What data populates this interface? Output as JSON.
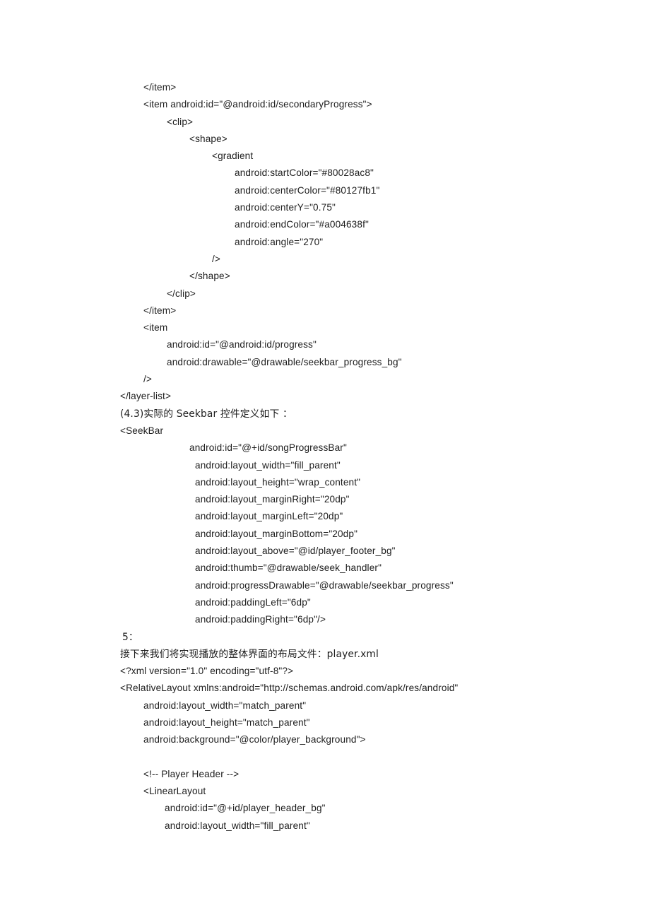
{
  "document": {
    "page_background": "#ffffff",
    "text_color": "#1d1d1d",
    "lines": [
      {
        "indent": "i1",
        "text": "</item>"
      },
      {
        "indent": "i1",
        "text": "<item android:id=\"@android:id/secondaryProgress\">"
      },
      {
        "indent": "i2",
        "text": "<clip>"
      },
      {
        "indent": "i3",
        "text": "<shape>"
      },
      {
        "indent": "i4",
        "text": "<gradient"
      },
      {
        "indent": "i5",
        "text": "android:startColor=\"#80028ac8\""
      },
      {
        "indent": "i5",
        "text": "android:centerColor=\"#80127fb1\""
      },
      {
        "indent": "i5",
        "text": "android:centerY=\"0.75\""
      },
      {
        "indent": "i5",
        "text": "android:endColor=\"#a004638f\""
      },
      {
        "indent": "i5",
        "text": "android:angle=\"270\""
      },
      {
        "indent": "i4",
        "text": "/>"
      },
      {
        "indent": "i3",
        "text": "</shape>"
      },
      {
        "indent": "i2",
        "text": "</clip>"
      },
      {
        "indent": "i1",
        "text": "</item>"
      },
      {
        "indent": "i1",
        "text": "<item"
      },
      {
        "indent": "i2",
        "text": "android:id=\"@android:id/progress\""
      },
      {
        "indent": "i2",
        "text": "android:drawable=\"@drawable/seekbar_progress_bg\""
      },
      {
        "indent": "i1",
        "text": "/>"
      },
      {
        "indent": "i0",
        "text": "</layer-list>"
      },
      {
        "indent": "i0",
        "text": "(4.3)实际的 Seekbar 控件定义如下 ：",
        "cjk": true
      },
      {
        "indent": "i0",
        "text": "<SeekBar"
      },
      {
        "indent": "sb-id",
        "text": "android:id=\"@+id/songProgressBar\""
      },
      {
        "indent": "sb-attr",
        "text": "android:layout_width=\"fill_parent\""
      },
      {
        "indent": "sb-attr",
        "text": "android:layout_height=\"wrap_content\""
      },
      {
        "indent": "sb-attr",
        "text": "android:layout_marginRight=\"20dp\""
      },
      {
        "indent": "sb-attr",
        "text": "android:layout_marginLeft=\"20dp\""
      },
      {
        "indent": "sb-attr",
        "text": "android:layout_marginBottom=\"20dp\""
      },
      {
        "indent": "sb-attr",
        "text": "android:layout_above=\"@id/player_footer_bg\""
      },
      {
        "indent": "sb-attr",
        "text": "android:thumb=\"@drawable/seek_handler\""
      },
      {
        "indent": "sb-attr",
        "text": "android:progressDrawable=\"@drawable/seekbar_progress\""
      },
      {
        "indent": "sb-attr",
        "text": "android:paddingLeft=\"6dp\""
      },
      {
        "indent": "sb-attr",
        "text": "android:paddingRight=\"6dp\"/>"
      },
      {
        "indent": "num5",
        "text": "5：",
        "cjk": true
      },
      {
        "indent": "i0",
        "text": "接下来我们将实现播放的整体界面的布局文件：player.xml",
        "cjk": true
      },
      {
        "indent": "i0",
        "text": "<?xml version=\"1.0\" encoding=\"utf-8\"?>"
      },
      {
        "indent": "i0",
        "text": "<RelativeLayout xmlns:android=\"http://schemas.android.com/apk/res/android\""
      },
      {
        "indent": "i1",
        "text": "android:layout_width=\"match_parent\""
      },
      {
        "indent": "i1",
        "text": "android:layout_height=\"match_parent\""
      },
      {
        "indent": "i1",
        "text": "android:background=\"@color/player_background\">"
      },
      {
        "indent": "i1",
        "text": "",
        "blank": true
      },
      {
        "indent": "i1",
        "text": "<!-- Player Header -->"
      },
      {
        "indent": "i1",
        "text": "<LinearLayout"
      },
      {
        "indent": "ll-attr",
        "text": "android:id=\"@+id/player_header_bg\""
      },
      {
        "indent": "ll-attr",
        "text": "android:layout_width=\"fill_parent\""
      }
    ]
  }
}
